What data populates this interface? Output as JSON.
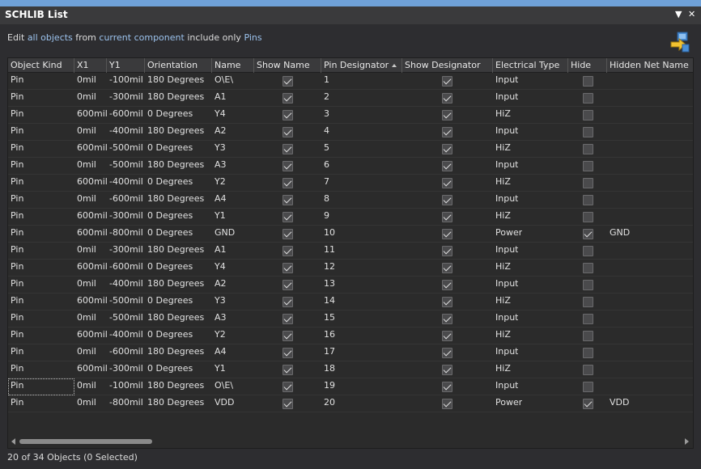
{
  "window": {
    "title": "SCHLIB List"
  },
  "toolbar": {
    "w1": "Edit",
    "w2": "all objects",
    "w3": "from",
    "w4": "current component",
    "w5": "include only",
    "w6": "Pins"
  },
  "table": {
    "columns": [
      "Object Kind",
      "X1",
      "Y1",
      "Orientation",
      "Name",
      "Show Name",
      "Pin Designator",
      "Show Designator",
      "Electrical Type",
      "Hide",
      "Hidden Net Name"
    ],
    "rows": [
      {
        "kind": "Pin",
        "x1": "0mil",
        "y1": "-100mil",
        "orient": "180 Degrees",
        "name": "O\\E\\",
        "show_name": true,
        "designator": "1",
        "show_des": true,
        "etype": "Input",
        "hide": false,
        "net": ""
      },
      {
        "kind": "Pin",
        "x1": "0mil",
        "y1": "-300mil",
        "orient": "180 Degrees",
        "name": "A1",
        "show_name": true,
        "designator": "2",
        "show_des": true,
        "etype": "Input",
        "hide": false,
        "net": ""
      },
      {
        "kind": "Pin",
        "x1": "600mil",
        "y1": "-600mil",
        "orient": "0 Degrees",
        "name": "Y4",
        "show_name": true,
        "designator": "3",
        "show_des": true,
        "etype": "HiZ",
        "hide": false,
        "net": ""
      },
      {
        "kind": "Pin",
        "x1": "0mil",
        "y1": "-400mil",
        "orient": "180 Degrees",
        "name": "A2",
        "show_name": true,
        "designator": "4",
        "show_des": true,
        "etype": "Input",
        "hide": false,
        "net": ""
      },
      {
        "kind": "Pin",
        "x1": "600mil",
        "y1": "-500mil",
        "orient": "0 Degrees",
        "name": "Y3",
        "show_name": true,
        "designator": "5",
        "show_des": true,
        "etype": "HiZ",
        "hide": false,
        "net": ""
      },
      {
        "kind": "Pin",
        "x1": "0mil",
        "y1": "-500mil",
        "orient": "180 Degrees",
        "name": "A3",
        "show_name": true,
        "designator": "6",
        "show_des": true,
        "etype": "Input",
        "hide": false,
        "net": ""
      },
      {
        "kind": "Pin",
        "x1": "600mil",
        "y1": "-400mil",
        "orient": "0 Degrees",
        "name": "Y2",
        "show_name": true,
        "designator": "7",
        "show_des": true,
        "etype": "HiZ",
        "hide": false,
        "net": ""
      },
      {
        "kind": "Pin",
        "x1": "0mil",
        "y1": "-600mil",
        "orient": "180 Degrees",
        "name": "A4",
        "show_name": true,
        "designator": "8",
        "show_des": true,
        "etype": "Input",
        "hide": false,
        "net": ""
      },
      {
        "kind": "Pin",
        "x1": "600mil",
        "y1": "-300mil",
        "orient": "0 Degrees",
        "name": "Y1",
        "show_name": true,
        "designator": "9",
        "show_des": true,
        "etype": "HiZ",
        "hide": false,
        "net": ""
      },
      {
        "kind": "Pin",
        "x1": "600mil",
        "y1": "-800mil",
        "orient": "0 Degrees",
        "name": "GND",
        "show_name": true,
        "designator": "10",
        "show_des": true,
        "etype": "Power",
        "hide": true,
        "net": "GND"
      },
      {
        "kind": "Pin",
        "x1": "0mil",
        "y1": "-300mil",
        "orient": "180 Degrees",
        "name": "A1",
        "show_name": true,
        "designator": "11",
        "show_des": true,
        "etype": "Input",
        "hide": false,
        "net": ""
      },
      {
        "kind": "Pin",
        "x1": "600mil",
        "y1": "-600mil",
        "orient": "0 Degrees",
        "name": "Y4",
        "show_name": true,
        "designator": "12",
        "show_des": true,
        "etype": "HiZ",
        "hide": false,
        "net": ""
      },
      {
        "kind": "Pin",
        "x1": "0mil",
        "y1": "-400mil",
        "orient": "180 Degrees",
        "name": "A2",
        "show_name": true,
        "designator": "13",
        "show_des": true,
        "etype": "Input",
        "hide": false,
        "net": ""
      },
      {
        "kind": "Pin",
        "x1": "600mil",
        "y1": "-500mil",
        "orient": "0 Degrees",
        "name": "Y3",
        "show_name": true,
        "designator": "14",
        "show_des": true,
        "etype": "HiZ",
        "hide": false,
        "net": ""
      },
      {
        "kind": "Pin",
        "x1": "0mil",
        "y1": "-500mil",
        "orient": "180 Degrees",
        "name": "A3",
        "show_name": true,
        "designator": "15",
        "show_des": true,
        "etype": "Input",
        "hide": false,
        "net": ""
      },
      {
        "kind": "Pin",
        "x1": "600mil",
        "y1": "-400mil",
        "orient": "0 Degrees",
        "name": "Y2",
        "show_name": true,
        "designator": "16",
        "show_des": true,
        "etype": "HiZ",
        "hide": false,
        "net": ""
      },
      {
        "kind": "Pin",
        "x1": "0mil",
        "y1": "-600mil",
        "orient": "180 Degrees",
        "name": "A4",
        "show_name": true,
        "designator": "17",
        "show_des": true,
        "etype": "Input",
        "hide": false,
        "net": ""
      },
      {
        "kind": "Pin",
        "x1": "600mil",
        "y1": "-300mil",
        "orient": "0 Degrees",
        "name": "Y1",
        "show_name": true,
        "designator": "18",
        "show_des": true,
        "etype": "HiZ",
        "hide": false,
        "net": ""
      },
      {
        "kind": "Pin",
        "x1": "0mil",
        "y1": "-100mil",
        "orient": "180 Degrees",
        "name": "O\\E\\",
        "show_name": true,
        "designator": "19",
        "show_des": true,
        "etype": "Input",
        "hide": false,
        "net": ""
      },
      {
        "kind": "Pin",
        "x1": "0mil",
        "y1": "-800mil",
        "orient": "180 Degrees",
        "name": "VDD",
        "show_name": true,
        "designator": "20",
        "show_des": true,
        "etype": "Power",
        "hide": true,
        "net": "VDD"
      }
    ]
  },
  "status": {
    "text": "20 of 34 Objects (0 Selected)"
  },
  "icons": {
    "menu": "dropdown-arrow-icon",
    "close": "close-icon",
    "apply": "apply-changes-icon"
  },
  "colors": {
    "accent": "#6fa1d8",
    "link": "#9cc3ee",
    "background": "#2d2d30"
  }
}
